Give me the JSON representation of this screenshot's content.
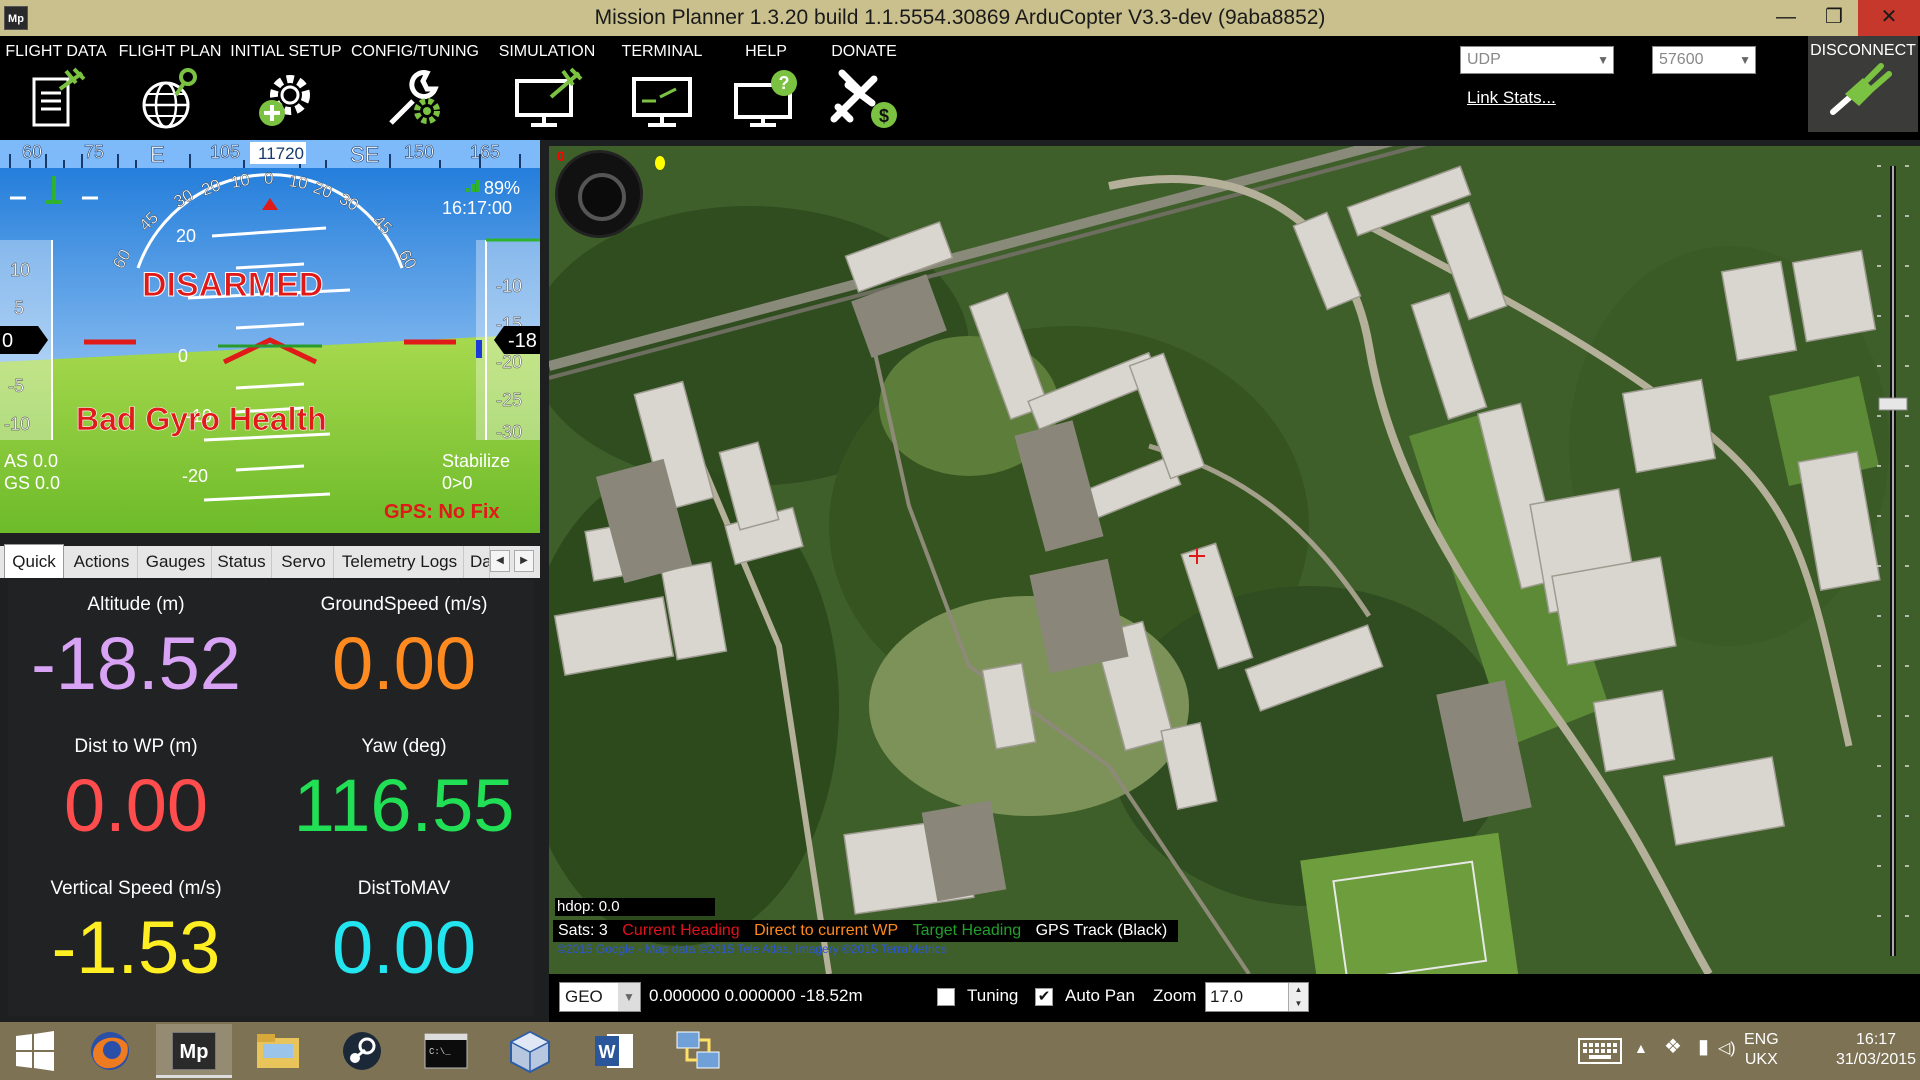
{
  "window": {
    "title": "Mission Planner 1.3.20 build 1.1.5554.30869 ArduCopter V3.3-dev (9aba8852)",
    "app_icon": "Mp",
    "minimize": "—",
    "maximize": "❐",
    "close": "✕"
  },
  "menu": {
    "items": [
      {
        "label": "FLIGHT DATA",
        "icon": "clipboard-plane-icon"
      },
      {
        "label": "FLIGHT PLAN",
        "icon": "globe-pin-icon"
      },
      {
        "label": "INITIAL SETUP",
        "icon": "gear-plus-icon"
      },
      {
        "label": "CONFIG/TUNING",
        "icon": "wrench-gear-icon"
      },
      {
        "label": "SIMULATION",
        "icon": "monitor-plane-icon"
      },
      {
        "label": "TERMINAL",
        "icon": "terminal-monitor-icon"
      },
      {
        "label": "HELP",
        "icon": "monitor-help-icon"
      },
      {
        "label": "DONATE",
        "icon": "plane-dollar-icon"
      }
    ],
    "connection_type": "UDP",
    "baud_rate": "57600",
    "link_stats": "Link Stats...",
    "disconnect": "DISCONNECT"
  },
  "hud": {
    "heading_ticks": [
      "60",
      "75",
      "E",
      "105",
      "11720",
      "SE",
      "150",
      "165"
    ],
    "status_armed": "DISARMED",
    "warning": "Bad Gyro Health",
    "battery": "89%",
    "time": "16:17:00",
    "airspeed": "AS 0.0",
    "groundspeed": "GS 0.0",
    "mode": "Stabilize",
    "wp": "0>0",
    "gps": "GPS: No Fix",
    "speed_tape": [
      "10",
      "5",
      "0",
      "-5",
      "-10"
    ],
    "speed_current": "0",
    "alt_tape": [
      "-10",
      "-15",
      "-20",
      "-25",
      "-30"
    ],
    "alt_current": "-18",
    "pitch_labels": [
      "20",
      "0",
      "-10",
      "-20"
    ],
    "roll_labels": [
      "60",
      "45",
      "30",
      "20",
      "10",
      "0",
      "10",
      "20",
      "30",
      "45",
      "60"
    ]
  },
  "tabs": [
    "Quick",
    "Actions",
    "Gauges",
    "Status",
    "Servo",
    "Telemetry Logs",
    "Da"
  ],
  "quick": [
    {
      "label": "Altitude (m)",
      "value": "-18.52",
      "color": "#d9a3f5"
    },
    {
      "label": "GroundSpeed (m/s)",
      "value": "0.00",
      "color": "#ff8a1f"
    },
    {
      "label": "Dist to WP (m)",
      "value": "0.00",
      "color": "#ff4d4d"
    },
    {
      "label": "Yaw (deg)",
      "value": "116.55",
      "color": "#22e055"
    },
    {
      "label": "Vertical Speed (m/s)",
      "value": "-1.53",
      "color": "#ffee22"
    },
    {
      "label": "DistToMAV",
      "value": "0.00",
      "color": "#22e5f0"
    }
  ],
  "map": {
    "marker_zero": "0",
    "hdop": "hdop: 0.0",
    "legend": [
      {
        "text": "Sats: 3",
        "color": "#ffffff"
      },
      {
        "text": "Current Heading",
        "color": "#e0121b"
      },
      {
        "text": "Direct to current WP",
        "color": "#ff8a1f"
      },
      {
        "text": "Target Heading",
        "color": "#22a02a"
      },
      {
        "text": "GPS Track (Black)",
        "color": "#ffffff"
      }
    ],
    "copyright": "©2015 Google - Map data ©2015 Tele Atlas, Imagery ©2015 TerraMetrics"
  },
  "bottom": {
    "coord_mode": "GEO",
    "coords": "0.000000 0.000000   -18.52m",
    "tuning_label": "Tuning",
    "tuning_checked": false,
    "autopan_label": "Auto Pan",
    "autopan_checked": true,
    "zoom_label": "Zoom",
    "zoom_value": "17.0"
  },
  "taskbar": {
    "apps": [
      "windows-start-icon",
      "firefox-icon",
      "mission-planner-icon",
      "file-explorer-icon",
      "steam-icon",
      "command-prompt-icon",
      "virtualbox-icon",
      "word-icon",
      "network-icon"
    ],
    "lang": "ENG",
    "layout": "UKX",
    "time": "16:17",
    "date": "31/03/2015"
  }
}
